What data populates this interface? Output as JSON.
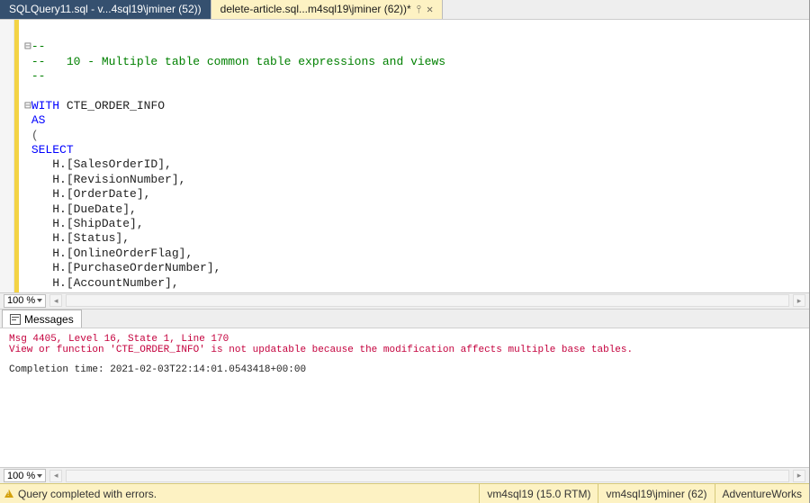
{
  "tabs": [
    {
      "label": "SQLQuery11.sql - v...4sql19\\jminer (52))",
      "active": false
    },
    {
      "label": "delete-article.sql...m4sql19\\jminer (62))*",
      "active": true
    }
  ],
  "zoom": {
    "editor": "100 %",
    "messages": "100 %"
  },
  "code": {
    "comment_prefix": "--",
    "comment_line_1": "--",
    "comment_text": "--   10 - Multiple table common table expressions and views",
    "comment_line_3": "--",
    "kw_with": "WITH",
    "cte_name": "CTE_ORDER_INFO",
    "kw_as": "AS",
    "open_paren": "(",
    "kw_select": "SELECT",
    "cols": [
      "H.[SalesOrderID],",
      "H.[RevisionNumber],",
      "H.[OrderDate],",
      "H.[DueDate],",
      "H.[ShipDate],",
      "H.[Status],",
      "H.[OnlineOrderFlag],",
      "H.[PurchaseOrderNumber],",
      "H.[AccountNumber],"
    ]
  },
  "messages_tab": "Messages",
  "messages": {
    "err_line1": "Msg 4405, Level 16, State 1, Line 170",
    "err_line2": "View or function 'CTE_ORDER_INFO' is not updatable because the modification affects multiple base tables.",
    "completion": "Completion time: 2021-02-03T22:14:01.0543418+00:00"
  },
  "status": {
    "text": "Query completed with errors.",
    "server": "vm4sql19 (15.0 RTM)",
    "login": "vm4sql19\\jminer (62)",
    "db": "AdventureWorks"
  }
}
